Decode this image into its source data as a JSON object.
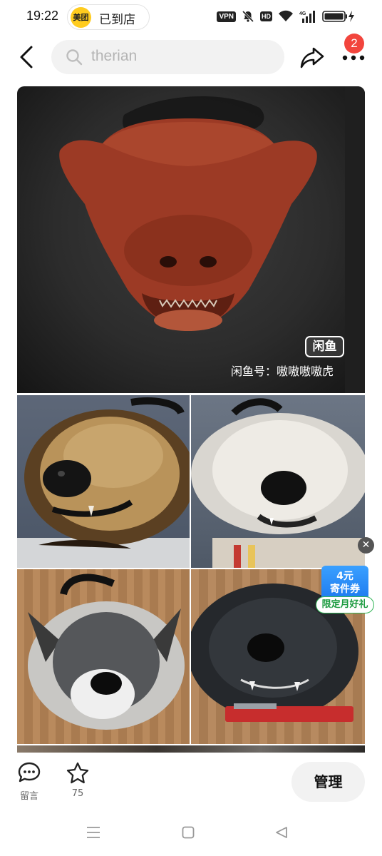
{
  "status_bar": {
    "time": "19:22",
    "store_logo": "美团",
    "store_text": "已到店",
    "vpn": "VPN",
    "hd": "HD",
    "network": "4G"
  },
  "header": {
    "search_value": "therian",
    "notification_count": "2"
  },
  "listing": {
    "logo_text": "闲鱼",
    "watermark": "闲鱼号：嗷嗷嗷嗷虎"
  },
  "promo": {
    "coupon_amount": "4元",
    "coupon_name": "寄件券",
    "coupon_tag": "限定月好礼"
  },
  "bottom_bar": {
    "message_label": "留言",
    "favorite_count": "75",
    "manage_label": "管理"
  },
  "colors": {
    "badge": "#f2453d",
    "coupon_blue": "#1f7cf0",
    "coupon_green": "#1a9a3e"
  }
}
